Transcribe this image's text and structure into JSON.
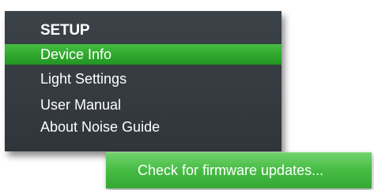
{
  "setup_menu": {
    "heading": "SETUP",
    "items": [
      {
        "label": "Device Info",
        "selected": true
      },
      {
        "label": "Light Settings",
        "selected": false
      },
      {
        "label": "User Manual",
        "selected": false
      },
      {
        "label": "About Noise Guide",
        "selected": false
      }
    ]
  },
  "firmware": {
    "button_label": "Check for firmware updates..."
  },
  "colors": {
    "panel_background": "#363c41",
    "accent_green": "#2ea82c",
    "text": "#ffffff"
  }
}
